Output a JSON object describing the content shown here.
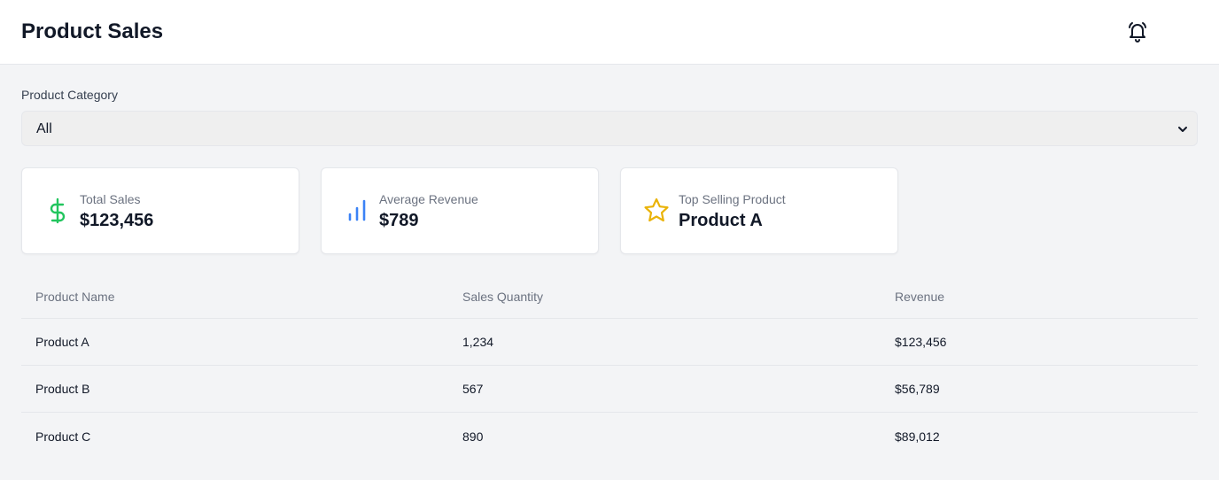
{
  "header": {
    "title": "Product Sales",
    "notification_icon": "bell-icon"
  },
  "filter": {
    "label": "Product Category",
    "selected": "All"
  },
  "stats": [
    {
      "label": "Total Sales",
      "value": "$123,456",
      "icon": "dollar-icon",
      "color": "#22c55e"
    },
    {
      "label": "Average Revenue",
      "value": "$789",
      "icon": "bar-chart-icon",
      "color": "#3b82f6"
    },
    {
      "label": "Top Selling Product",
      "value": "Product A",
      "icon": "star-icon",
      "color": "#eab308"
    }
  ],
  "table": {
    "columns": [
      "Product Name",
      "Sales Quantity",
      "Revenue"
    ],
    "rows": [
      [
        "Product A",
        "1,234",
        "$123,456"
      ],
      [
        "Product B",
        "567",
        "$56,789"
      ],
      [
        "Product C",
        "890",
        "$89,012"
      ]
    ]
  }
}
